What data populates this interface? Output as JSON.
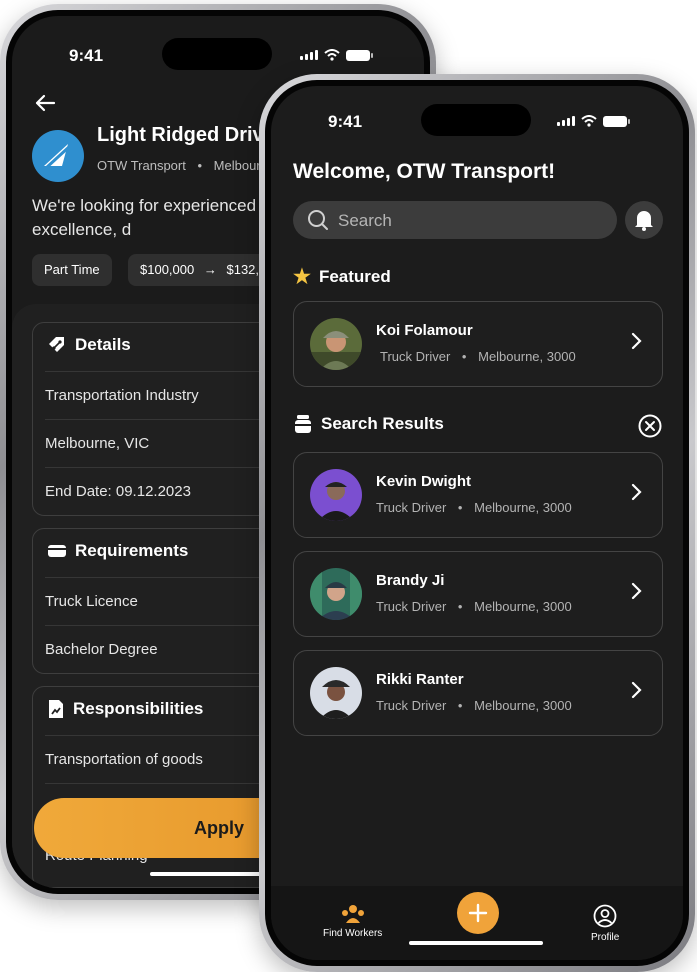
{
  "status_bar": {
    "time": "9:41"
  },
  "job_screen": {
    "title": "Light Ridged Driv",
    "company": "OTW Transport",
    "location": "Melbour",
    "description": "We're looking for experienced ready to deliver excellence, d",
    "chips": [
      "Part Time",
      "$100,000",
      "$132,0"
    ],
    "details": {
      "heading": "Details",
      "items": [
        "Transportation Industry",
        "Melbourne, VIC",
        "End Date: 09.12.2023"
      ]
    },
    "requirements": {
      "heading": "Requirements",
      "items": [
        "Truck Licence",
        "Bachelor Degree"
      ]
    },
    "responsibilities": {
      "heading": "Responsibilities",
      "items": [
        "Transportation of goods",
        "Route Planning"
      ]
    },
    "apply_label": "Apply"
  },
  "search_screen": {
    "welcome": "Welcome, OTW Transport!",
    "search_placeholder": "Search",
    "featured_heading": "Featured",
    "featured": {
      "name": "Koi Folamour",
      "role": "Truck Driver",
      "location": "Melbourne, 3000"
    },
    "results_heading": "Search Results",
    "results": [
      {
        "name": "Kevin Dwight",
        "role": "Truck Driver",
        "location": "Melbourne, 3000"
      },
      {
        "name": "Brandy Ji",
        "role": "Truck Driver",
        "location": "Melbourne, 3000"
      },
      {
        "name": "Rikki Ranter",
        "role": "Truck Driver",
        "location": "Melbourne, 3000"
      }
    ],
    "nav": {
      "find_workers": "Find Workers",
      "profile": "Profile"
    }
  },
  "colors": {
    "accent": "#f0a33a",
    "background": "#1b1b1b",
    "card_border": "#444444"
  }
}
